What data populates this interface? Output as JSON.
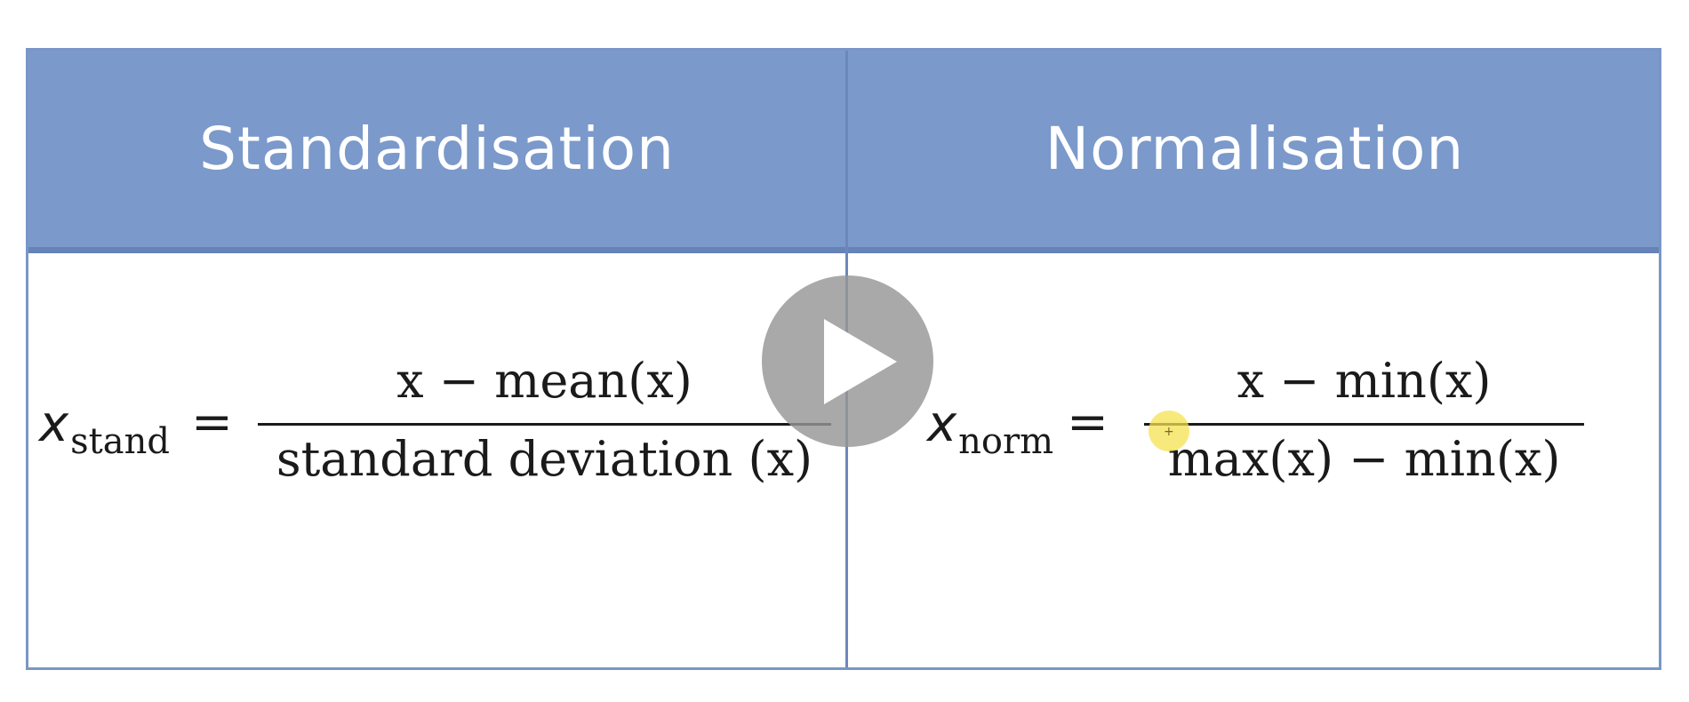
{
  "table": {
    "headers": [
      "Standardisation",
      "Normalisation"
    ],
    "header_color": "#7b99ca",
    "border_color": "#7a96c6"
  },
  "standardisation": {
    "var": "x",
    "sub": "stand",
    "eq": "=",
    "numerator": "x − mean(x)",
    "denominator": "standard deviation (x)"
  },
  "normalisation": {
    "var": "x",
    "sub": "norm",
    "eq": "=",
    "numerator": "x − min(x)",
    "denominator": "max(x) − min(x)"
  },
  "overlay": {
    "play_icon": "play-icon",
    "cursor_icon": "cursor-highlight-icon"
  }
}
